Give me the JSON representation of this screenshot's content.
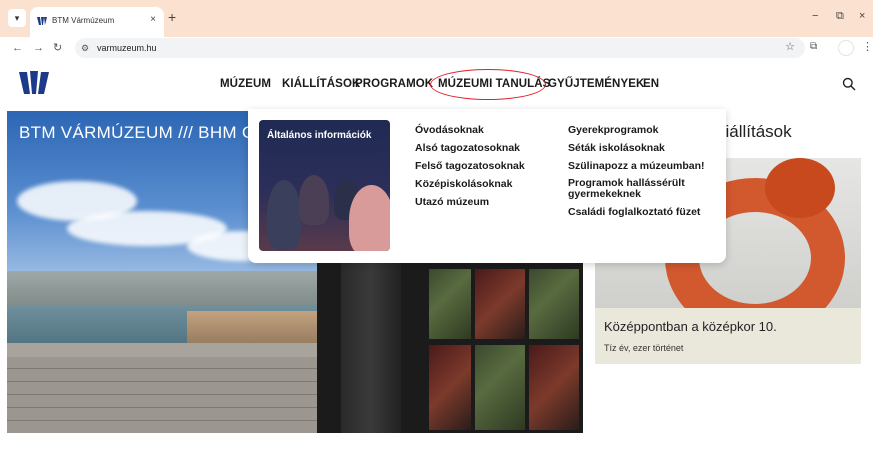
{
  "browser": {
    "tab_title": "BTM Vármúzeum",
    "tab_close": "×",
    "new_tab": "+",
    "url": "varmuzeum.hu",
    "window_min": "−",
    "window_restore": "⧉",
    "window_close": "×"
  },
  "nav": {
    "items": [
      "MÚZEUM",
      "KIÁLLÍTÁSOK",
      "PROGRAMOK",
      "MÚZEUMI TANULÁS",
      "GYŰJTEMÉNYEK",
      "EN"
    ],
    "active": "MÚZEUMI TANULÁS"
  },
  "dropdown": {
    "promo_label": "Általános információk",
    "col1": [
      "Óvodásoknak",
      "Alsó tagozatosoknak",
      "Felső tagozatosoknak",
      "Középiskolásoknak",
      "Utazó múzeum"
    ],
    "col2": [
      "Gyerekprogramok",
      "Séták iskolásoknak",
      "Szülinapozz a múzeumban!",
      "Programok hallássérült gyermekeknek",
      "Családi foglalkoztató füzet"
    ]
  },
  "hero": {
    "title": "BTM VÁRMÚZEUM /// BHM C"
  },
  "side": {
    "title": "kiállítások",
    "card_title": "Középpontban a középkor 10.",
    "card_subtitle": "Tíz év, ezer történet"
  },
  "colors": {
    "tabbar": "#fbe1cf",
    "accent_circle": "#d9232d",
    "logo": "#1d3a8a",
    "card_bg": "#eae7db",
    "glass": "#d2582e"
  }
}
